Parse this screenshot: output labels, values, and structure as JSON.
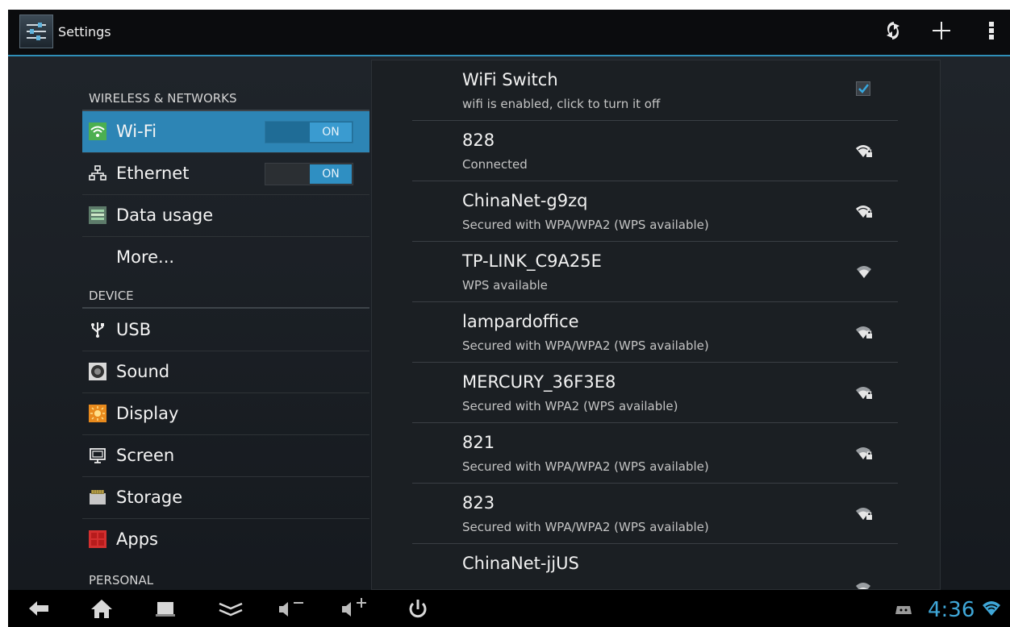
{
  "actionbar": {
    "title": "Settings",
    "buttons": [
      "sync-icon",
      "add-icon",
      "overflow-menu-icon"
    ]
  },
  "sidebar": {
    "wireless_header": "WIRELESS & NETWORKS",
    "device_header": "DEVICE",
    "personal_header": "PERSONAL",
    "items": [
      {
        "label": "Wi-Fi",
        "icon": "wifi-icon",
        "toggle": "ON",
        "selected": true
      },
      {
        "label": "Ethernet",
        "icon": "ethernet-icon",
        "toggle": "ON"
      },
      {
        "label": "Data usage",
        "icon": "data-usage-icon"
      },
      {
        "label": "More..."
      },
      {
        "label": "USB",
        "icon": "usb-icon"
      },
      {
        "label": "Sound",
        "icon": "sound-icon"
      },
      {
        "label": "Display",
        "icon": "display-icon"
      },
      {
        "label": "Screen",
        "icon": "screen-icon"
      },
      {
        "label": "Storage",
        "icon": "storage-icon"
      },
      {
        "label": "Apps",
        "icon": "apps-icon"
      }
    ]
  },
  "wifi": {
    "switch_title": "WiFi Switch",
    "switch_summary": "wifi is enabled, click to turn it off",
    "switch_checked": true,
    "networks": [
      {
        "ssid": "828",
        "status": "Connected",
        "secured": true
      },
      {
        "ssid": "ChinaNet-g9zq",
        "status": "Secured with WPA/WPA2 (WPS available)",
        "secured": true
      },
      {
        "ssid": "TP-LINK_C9A25E",
        "status": "WPS available",
        "secured": false
      },
      {
        "ssid": "lampardoffice",
        "status": "Secured with WPA/WPA2 (WPS available)",
        "secured": true
      },
      {
        "ssid": "MERCURY_36F3E8",
        "status": "Secured with WPA2 (WPS available)",
        "secured": true
      },
      {
        "ssid": "821",
        "status": "Secured with WPA/WPA2 (WPS available)",
        "secured": true
      },
      {
        "ssid": "823",
        "status": "Secured with WPA/WPA2 (WPS available)",
        "secured": true
      },
      {
        "ssid": "ChinaNet-jjUS",
        "status": "",
        "secured": true
      }
    ]
  },
  "navbar": {
    "buttons": [
      "back-icon",
      "home-icon",
      "recent-apps-icon",
      "hide-bar-icon",
      "volume-down-icon",
      "volume-up-icon",
      "power-icon"
    ],
    "time": "4:36"
  },
  "colors": {
    "accent": "#2f8fc2",
    "selected_item": "#2d85b5",
    "clock": "#3fa7d8"
  }
}
